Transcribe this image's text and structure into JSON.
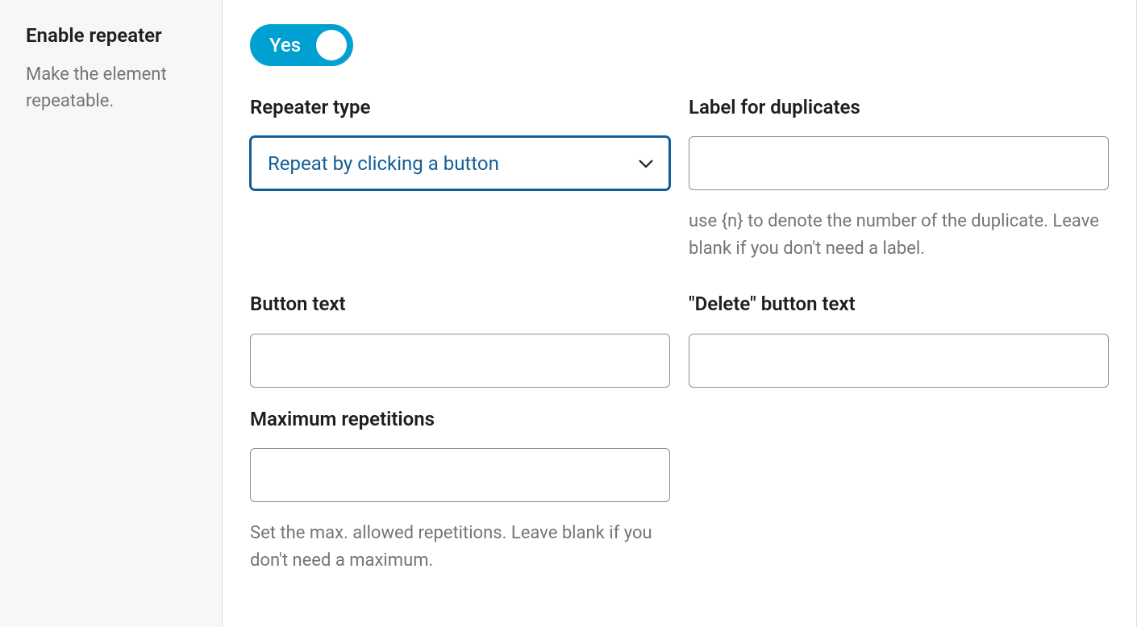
{
  "sidebar": {
    "title": "Enable repeater",
    "description": "Make the element repeatable."
  },
  "toggle": {
    "label": "Yes",
    "state": true
  },
  "fields": {
    "repeater_type": {
      "label": "Repeater type",
      "value": "Repeat by clicking a button"
    },
    "label_duplicates": {
      "label": "Label for duplicates",
      "value": "",
      "help": "use {n} to denote the number of the duplicate. Leave blank if you don't need a label."
    },
    "button_text": {
      "label": "Button text",
      "value": ""
    },
    "delete_button_text": {
      "label": "\"Delete\" button text",
      "value": ""
    },
    "max_repetitions": {
      "label": "Maximum repetitions",
      "value": "",
      "help": "Set the max. allowed repetitions. Leave blank if you don't need a maximum."
    }
  }
}
